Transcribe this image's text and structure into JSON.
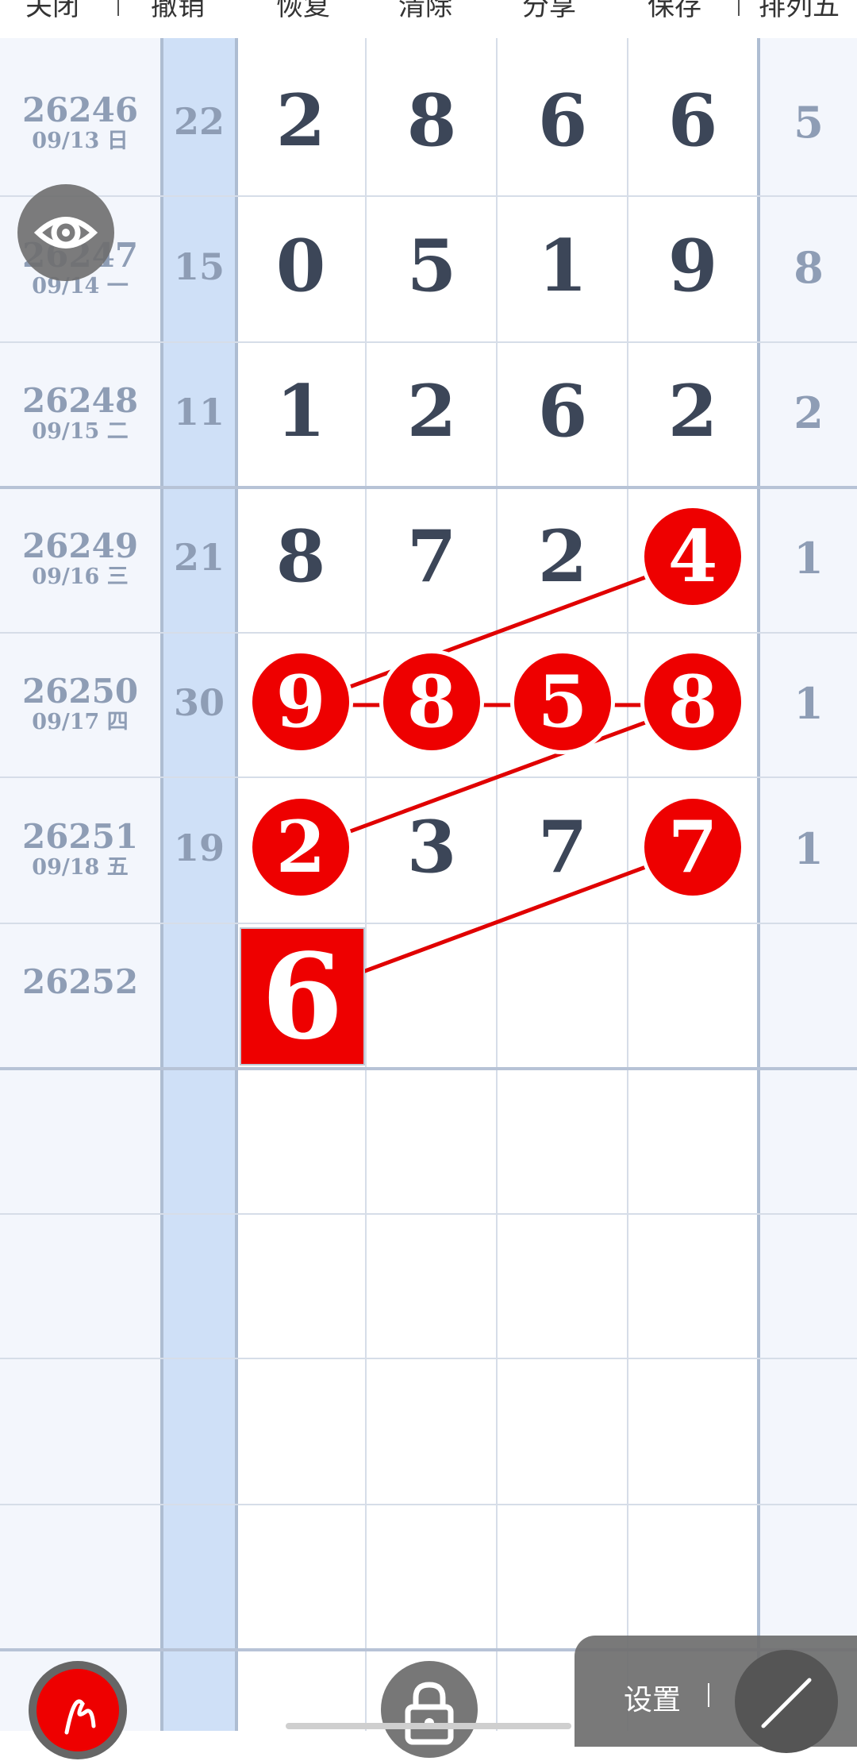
{
  "toolbar": {
    "close": "关闭",
    "undo": "撤销",
    "redo": "恢复",
    "clear": "清除",
    "share": "分享",
    "save": "保存",
    "mode": "排列五"
  },
  "rows": [
    {
      "issue": "26246",
      "date": "09/13 日",
      "sum": "22",
      "digits": [
        "2",
        "8",
        "6",
        "6"
      ],
      "p5": "5"
    },
    {
      "issue": "26247",
      "date": "09/14 一",
      "sum": "15",
      "digits": [
        "0",
        "5",
        "1",
        "9"
      ],
      "p5": "8"
    },
    {
      "issue": "26248",
      "date": "09/15 二",
      "sum": "11",
      "digits": [
        "1",
        "2",
        "6",
        "2"
      ],
      "p5": "2"
    },
    {
      "issue": "26249",
      "date": "09/16 三",
      "sum": "21",
      "digits": [
        "8",
        "7",
        "2",
        "4"
      ],
      "p5": "1"
    },
    {
      "issue": "26250",
      "date": "09/17 四",
      "sum": "30",
      "digits": [
        "9",
        "8",
        "5",
        "8"
      ],
      "p5": "1"
    },
    {
      "issue": "26251",
      "date": "09/18 五",
      "sum": "19",
      "digits": [
        "2",
        "3",
        "7",
        "7"
      ],
      "p5": "1"
    },
    {
      "issue": "26252",
      "date": "",
      "sum": "",
      "digits": [
        "6",
        "",
        "",
        ""
      ],
      "p5": ""
    }
  ],
  "highlights": [
    [
      3,
      3
    ],
    [
      4,
      0
    ],
    [
      4,
      1
    ],
    [
      4,
      2
    ],
    [
      4,
      3
    ],
    [
      5,
      0
    ],
    [
      5,
      3
    ]
  ],
  "current_pick": "6",
  "settings": {
    "label": "设置"
  },
  "colors": {
    "accent": "#ee0000",
    "sum_column": "#cfe0f7",
    "digit_text": "#3c4658",
    "muted_text": "#8e9db5"
  },
  "icons": [
    "eye-icon",
    "pen-icon",
    "lock-icon",
    "line-tool-icon"
  ]
}
